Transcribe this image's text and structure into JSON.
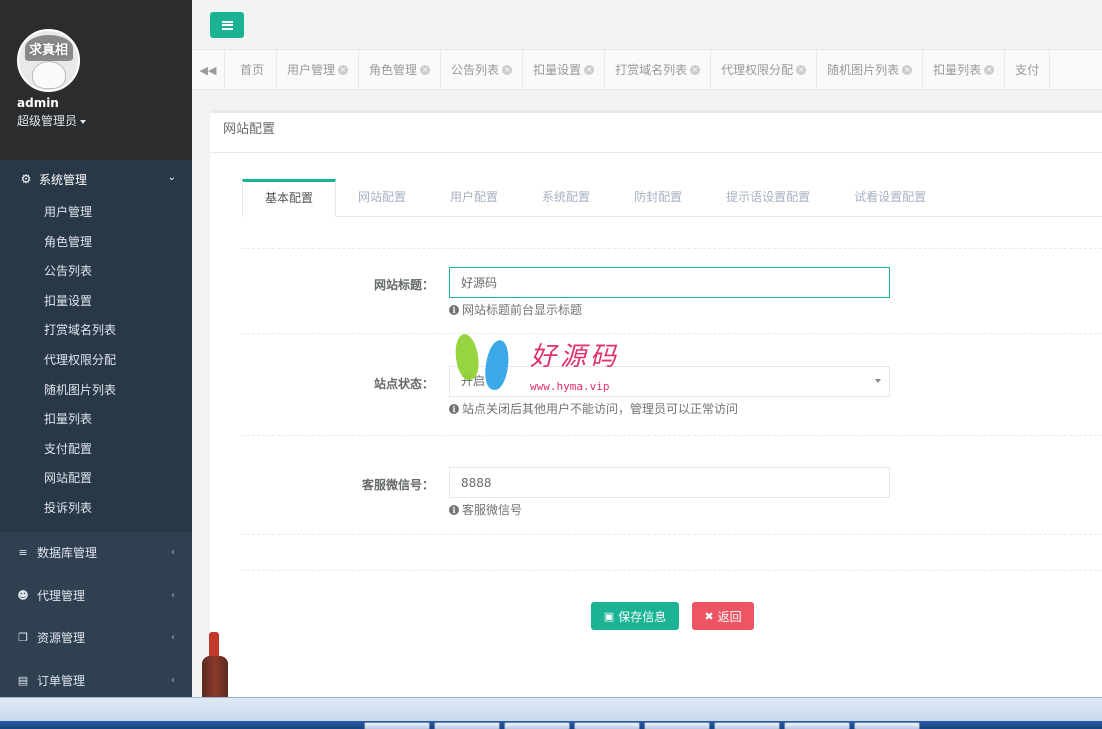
{
  "sidebar": {
    "avatar_text": "求真相",
    "username": "admin",
    "role": "超级管理员",
    "active_group": {
      "label": "系统管理",
      "icon": "gear-icon",
      "items": [
        "用户管理",
        "角色管理",
        "公告列表",
        "扣量设置",
        "打赏域名列表",
        "代理权限分配",
        "随机图片列表",
        "扣量列表",
        "支付配置",
        "网站配置",
        "投诉列表"
      ]
    },
    "groups": [
      {
        "label": "数据库管理",
        "icon": "database-icon"
      },
      {
        "label": "代理管理",
        "icon": "users-icon"
      },
      {
        "label": "资源管理",
        "icon": "files-icon"
      },
      {
        "label": "订单管理",
        "icon": "list-icon"
      }
    ]
  },
  "page_tabs": [
    {
      "label": "首页",
      "closable": false
    },
    {
      "label": "用户管理",
      "closable": true
    },
    {
      "label": "角色管理",
      "closable": true
    },
    {
      "label": "公告列表",
      "closable": true
    },
    {
      "label": "扣量设置",
      "closable": true
    },
    {
      "label": "打赏域名列表",
      "closable": true
    },
    {
      "label": "代理权限分配",
      "closable": true
    },
    {
      "label": "随机图片列表",
      "closable": true
    },
    {
      "label": "扣量列表",
      "closable": true
    },
    {
      "label": "支付",
      "closable": false
    }
  ],
  "panel": {
    "title": "网站配置",
    "config_tabs": [
      "基本配置",
      "网站配置",
      "用户配置",
      "系统配置",
      "防封配置",
      "提示语设置配置",
      "试看设置配置"
    ],
    "fields": {
      "site_title": {
        "label": "网站标题：",
        "value": "好源码",
        "help": "网站标题前台显示标题"
      },
      "site_status": {
        "label": "站点状态：",
        "value": "开启",
        "help": "站点关闭后其他用户不能访问，管理员可以正常访问"
      },
      "wechat": {
        "label": "客服微信号：",
        "value": "8888",
        "help": "客服微信号"
      }
    },
    "save_label": "保存信息",
    "back_label": "返回"
  },
  "watermark": {
    "text": "好源码",
    "url": "www.hyma.vip"
  },
  "colors": {
    "primary": "#1ab394",
    "danger": "#ed5565",
    "sidebar": "#2f4050"
  }
}
